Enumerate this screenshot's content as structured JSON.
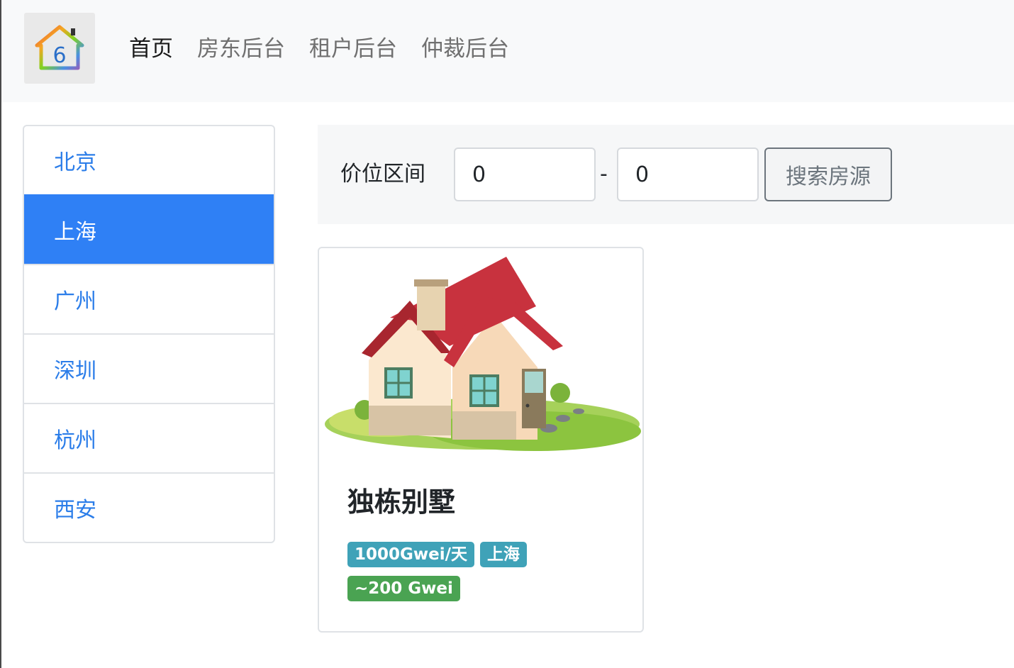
{
  "nav": {
    "logo_icon": "home-logo-icon",
    "links": [
      {
        "label": "首页",
        "active": true
      },
      {
        "label": "房东后台",
        "active": false
      },
      {
        "label": "租户后台",
        "active": false
      },
      {
        "label": "仲裁后台",
        "active": false
      }
    ]
  },
  "sidebar": {
    "cities": [
      {
        "label": "北京",
        "active": false
      },
      {
        "label": "上海",
        "active": true
      },
      {
        "label": "广州",
        "active": false
      },
      {
        "label": "深圳",
        "active": false
      },
      {
        "label": "杭州",
        "active": false
      },
      {
        "label": "西安",
        "active": false
      }
    ]
  },
  "filter": {
    "label": "价位区间",
    "min_value": "0",
    "max_value": "0",
    "separator": "-",
    "search_label": "搜索房源"
  },
  "listings": [
    {
      "title": "独栋别墅",
      "image_icon": "house-illustration",
      "price_badge": "1000Gwei/天",
      "city_badge": "上海",
      "deposit_badge": "~200 Gwei"
    }
  ],
  "colors": {
    "primary": "#2f80f5",
    "link": "#2b7de9",
    "info": "#3fa2b8",
    "success": "#4aa352",
    "secondary": "#6c757d"
  }
}
